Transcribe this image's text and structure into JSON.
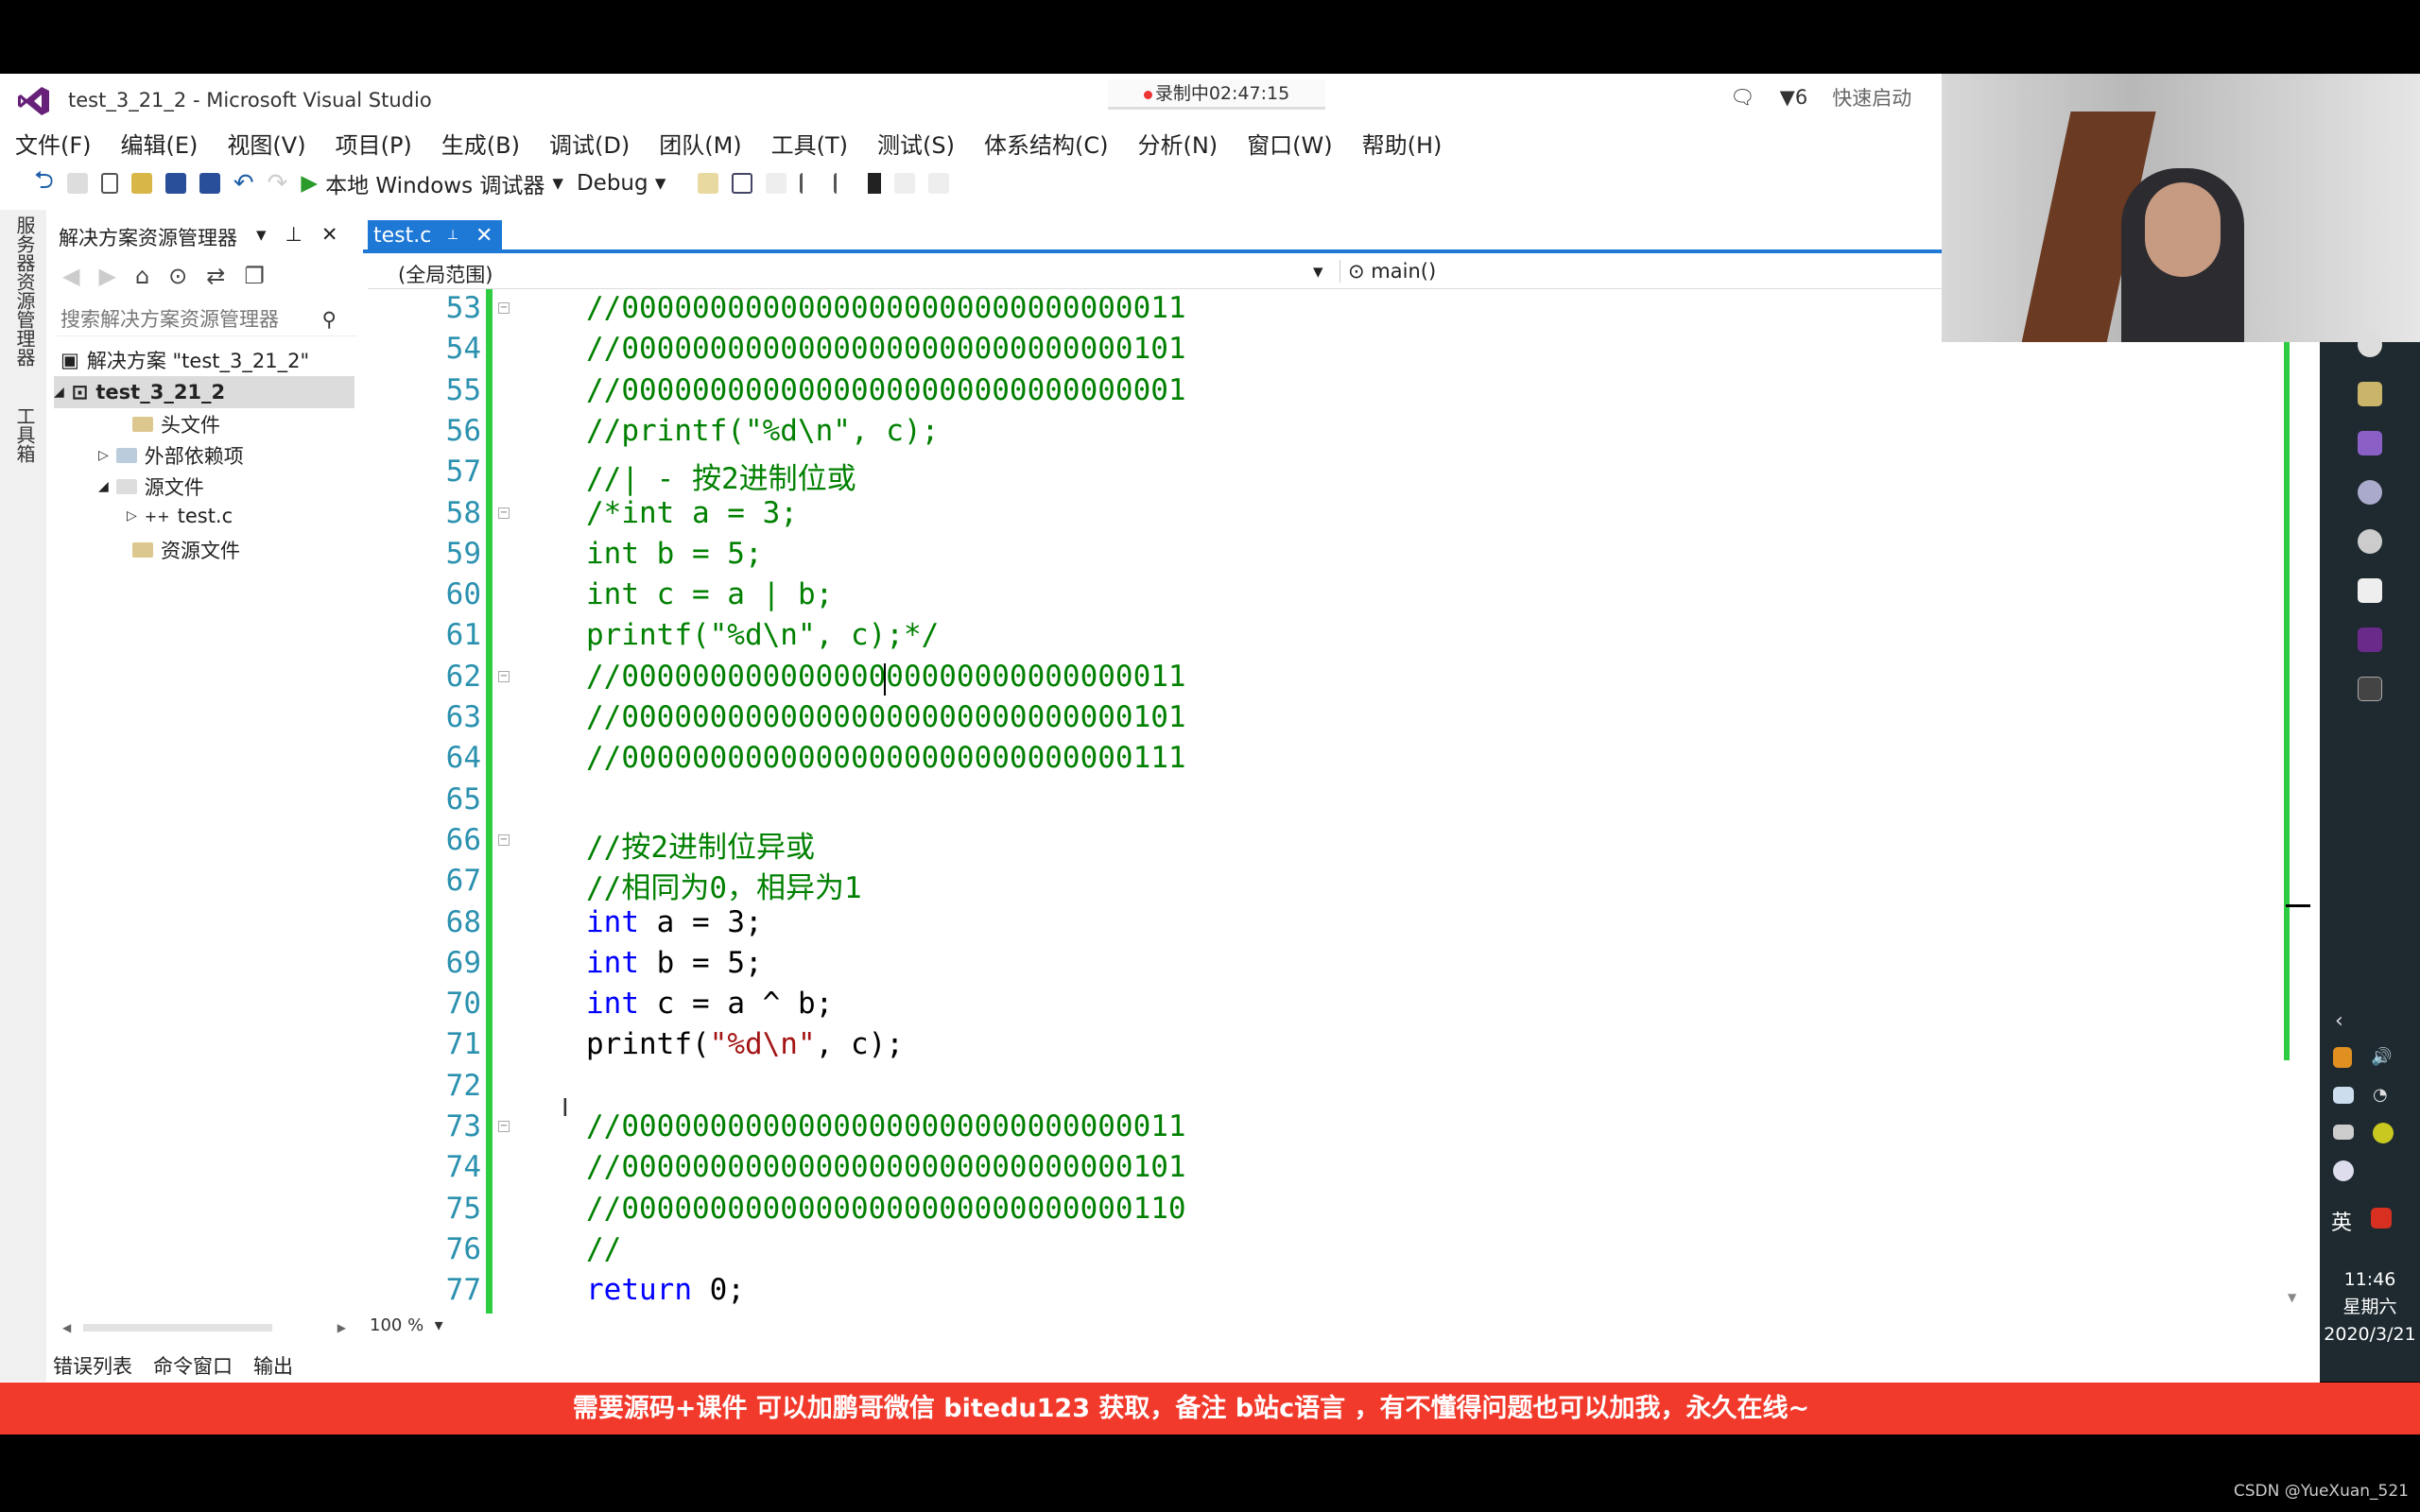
{
  "window": {
    "title": "test_3_21_2 - Microsoft Visual Studio",
    "recording": "录制中02:47:15",
    "notifications": "6",
    "quick_launch": "快速启动"
  },
  "menu": [
    "文件(F)",
    "编辑(E)",
    "视图(V)",
    "项目(P)",
    "生成(B)",
    "调试(D)",
    "团队(M)",
    "工具(T)",
    "测试(S)",
    "体系结构(C)",
    "分析(N)",
    "窗口(W)",
    "帮助(H)"
  ],
  "toolbar": {
    "run_label": "本地 Windows 调试器",
    "config": "Debug"
  },
  "left_strip": {
    "server_explorer": "服务器资源管理器",
    "toolbox": "工具箱"
  },
  "solution_explorer": {
    "title": "解决方案资源管理器",
    "search_placeholder": "搜索解决方案资源管理器",
    "solution": "解决方案 \"test_3_21_2\"",
    "project": "test_3_21_2",
    "items": [
      "头文件",
      "外部依赖项",
      "源文件",
      "test.c",
      "资源文件"
    ]
  },
  "editor": {
    "tab": "test.c",
    "scope": "(全局范围)",
    "function": "main()",
    "zoom": "100 %",
    "first_line": 53,
    "lines": [
      "//00000000000000000000000000000011",
      "//00000000000000000000000000000101",
      "//00000000000000000000000000000001",
      "//printf(\"%d\\n\", c);",
      "//| - 按2进制位或",
      "/*int a = 3;",
      "int b = 5;",
      "int c = a | b;",
      "printf(\"%d\\n\", c);*/",
      "//00000000000000000000000000000011",
      "//00000000000000000000000000000101",
      "//00000000000000000000000000000111",
      "",
      "//按2进制位异或",
      "//相同为0，相异为1",
      "int a = 3;",
      "int b = 5;",
      "int c = a ^ b;",
      "printf(\"%d\\n\", c);",
      "",
      "//00000000000000000000000000000011",
      "//00000000000000000000000000000101",
      "//00000000000000000000000000000110",
      "//",
      "return 0;"
    ],
    "fold_lines": [
      53,
      58,
      62,
      66,
      73
    ],
    "colors": {
      "comment": "#008000",
      "keyword": "#0000ff",
      "string": "#a31515",
      "line_number": "#2b91af"
    }
  },
  "bottom_tabs": [
    "错误列表",
    "命令窗口",
    "输出"
  ],
  "taskbar": {
    "time": "11:46",
    "weekday": "星期六",
    "date": "2020/3/21",
    "ime": "英"
  },
  "banner": "需要源码+课件 可以加鹏哥微信 bitedu123 获取，备注 b站c语言 ，有不懂得问题也可以加我，永久在线~",
  "watermark": "CSDN @YueXuan_521"
}
